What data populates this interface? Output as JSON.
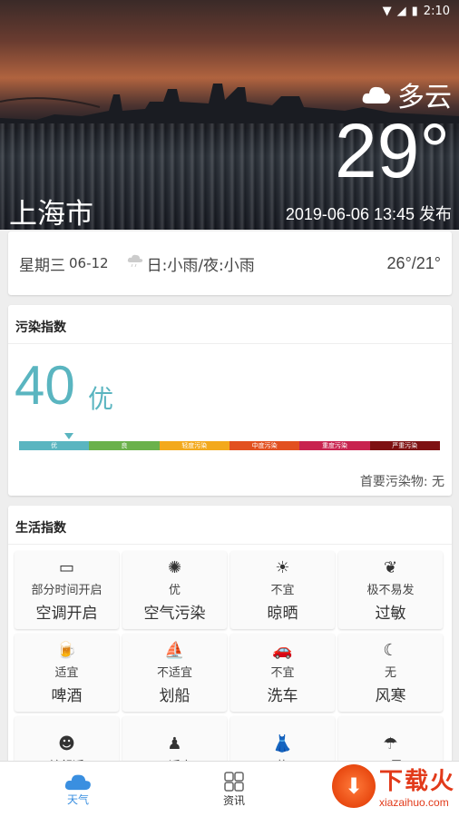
{
  "status_bar": {
    "time": "2:10"
  },
  "header": {
    "condition": "多云",
    "temperature": "29°",
    "city": "上海市",
    "published": "2019-06-06 13:45 发布"
  },
  "forecast": {
    "weekday": "星期三",
    "date": "06-12",
    "description": "日:小雨/夜:小雨",
    "temp_range": "26°/21°"
  },
  "pollution": {
    "title": "污染指数",
    "aqi": "40",
    "level": "优",
    "scale": [
      "优",
      "良",
      "轻度污染",
      "中度污染",
      "重度污染",
      "严重污染"
    ],
    "scale_colors": [
      "#5ab5c0",
      "#6bb14b",
      "#f3a91c",
      "#e2501f",
      "#c8234f",
      "#7e1112"
    ],
    "primary_pollutant": "首要污染物: 无"
  },
  "life_index": {
    "title": "生活指数",
    "items": [
      {
        "icon": "air-conditioner-icon",
        "glyph": "▭",
        "sub": "部分时间开启",
        "name": "空调开启"
      },
      {
        "icon": "pollution-icon",
        "glyph": "✺",
        "sub": "优",
        "name": "空气污染"
      },
      {
        "icon": "sun-icon",
        "glyph": "☀",
        "sub": "不宜",
        "name": "晾晒"
      },
      {
        "icon": "allergy-icon",
        "glyph": "❦",
        "sub": "极不易发",
        "name": "过敏"
      },
      {
        "icon": "beer-icon",
        "glyph": "🍺",
        "sub": "适宜",
        "name": "啤酒"
      },
      {
        "icon": "boat-icon",
        "glyph": "⛵",
        "sub": "不适宜",
        "name": "划船"
      },
      {
        "icon": "car-wash-icon",
        "glyph": "🚗",
        "sub": "不宜",
        "name": "洗车"
      },
      {
        "icon": "wind-chill-icon",
        "glyph": "☾",
        "sub": "无",
        "name": "风寒"
      },
      {
        "icon": "comfort-icon",
        "glyph": "☻",
        "sub": "较舒适",
        "name": ""
      },
      {
        "icon": "dating-icon",
        "glyph": "♟",
        "sub": "不适宜",
        "name": ""
      },
      {
        "icon": "dress-icon",
        "glyph": "👗",
        "sub": "热",
        "name": ""
      },
      {
        "icon": "umbrella-icon",
        "glyph": "☂",
        "sub": "不需",
        "name": ""
      }
    ]
  },
  "nav": {
    "weather": "天气",
    "news": "资讯"
  },
  "watermark": {
    "big": "下载火",
    "small": "xiazaihuo.com"
  }
}
